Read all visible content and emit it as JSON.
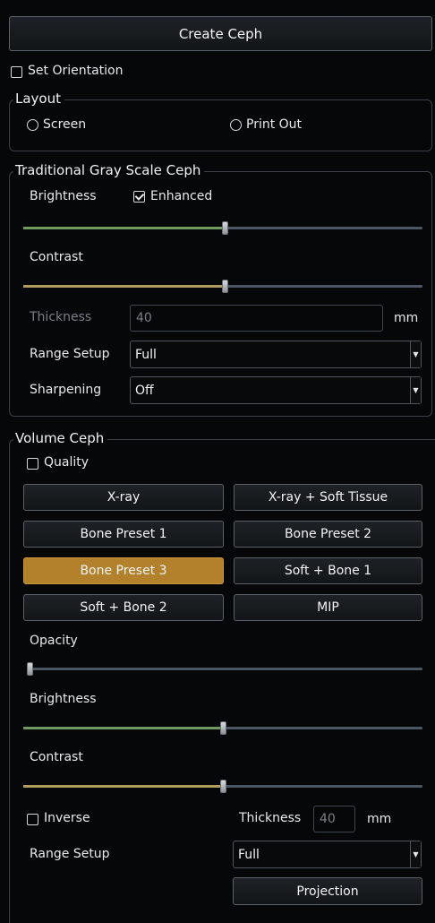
{
  "create_button": "Create Ceph",
  "set_orientation": {
    "label": "Set Orientation",
    "checked": false
  },
  "layout": {
    "title": "Layout",
    "screen": {
      "label": "Screen",
      "selected": true
    },
    "print_out": {
      "label": "Print Out",
      "selected": false
    }
  },
  "traditional": {
    "title": "Traditional Gray Scale Ceph",
    "brightness_label": "Brightness",
    "enhanced": {
      "label": "Enhanced",
      "checked": true
    },
    "brightness_value": 0.5,
    "contrast_label": "Contrast",
    "contrast_value": 0.5,
    "thickness_label": "Thickness",
    "thickness_value": "40",
    "thickness_unit": "mm",
    "range_label": "Range Setup",
    "range_value": "Full",
    "sharpening_label": "Sharpening",
    "sharpening_value": "Off"
  },
  "volume": {
    "title": "Volume Ceph",
    "quality": {
      "label": "Quality",
      "checked": false
    },
    "presets": [
      {
        "label": "X-ray",
        "active": false
      },
      {
        "label": "X-ray + Soft Tissue",
        "active": false
      },
      {
        "label": "Bone Preset 1",
        "active": false
      },
      {
        "label": "Bone Preset 2",
        "active": false
      },
      {
        "label": "Bone Preset 3",
        "active": true
      },
      {
        "label": "Soft + Bone 1",
        "active": false
      },
      {
        "label": "Soft + Bone 2",
        "active": false
      },
      {
        "label": "MIP",
        "active": false
      }
    ],
    "opacity_label": "Opacity",
    "opacity_value": 0.0,
    "brightness_label": "Brightness",
    "brightness_value": 0.5,
    "contrast_label": "Contrast",
    "contrast_value": 0.5,
    "inverse": {
      "label": "Inverse",
      "checked": false
    },
    "thickness_label": "Thickness",
    "thickness_value": "40",
    "thickness_unit": "mm",
    "range_label": "Range Setup",
    "range_value": "Full",
    "projection_button": "Projection"
  },
  "colors": {
    "accent_active": "#b3812c",
    "brightness_fill": "#6e9a5e",
    "contrast_fill": "#b09a5c"
  }
}
